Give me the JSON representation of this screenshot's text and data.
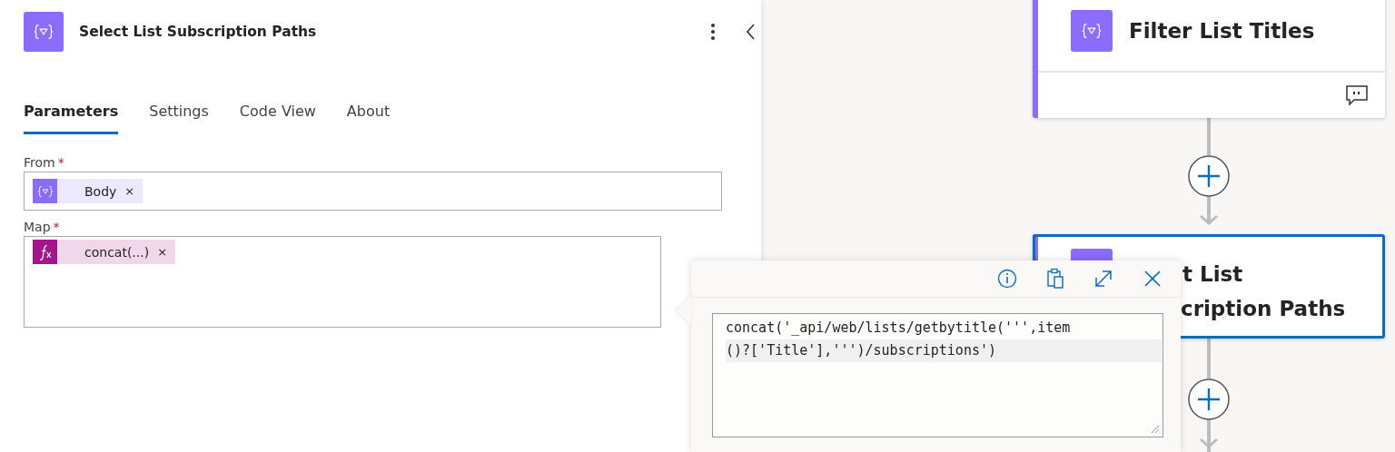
{
  "panel": {
    "title": "Select List Subscription Paths",
    "tabs": [
      {
        "label": "Parameters",
        "selected": true
      },
      {
        "label": "Settings",
        "selected": false
      },
      {
        "label": "Code View",
        "selected": false
      },
      {
        "label": "About",
        "selected": false
      }
    ],
    "fields": [
      {
        "label": "From",
        "required_mark": "*",
        "token": {
          "kind": "variable",
          "text": "Body",
          "remove": "×"
        }
      },
      {
        "label": "Map",
        "required_mark": "*",
        "token": {
          "kind": "expression",
          "text": "concat(...)",
          "remove": "×"
        }
      }
    ]
  },
  "expression_popup": {
    "code_lines": [
      "concat('_api/web/lists/getbytitle(''',item",
      "()?['Title'],''')/subscriptions')"
    ]
  },
  "flow": {
    "nodes": [
      {
        "title_lines": [
          "Filter List Titles"
        ],
        "selected": false,
        "has_footer": true
      },
      {
        "title_lines": [
          "t List",
          "cription Paths"
        ],
        "selected": true,
        "has_footer": false
      }
    ]
  }
}
